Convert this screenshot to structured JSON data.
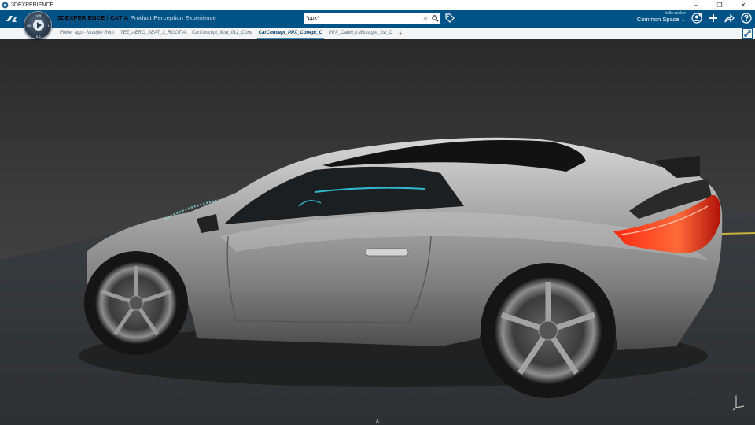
{
  "os": {
    "title": "3DEXPERIENCE",
    "minimize_glyph": "–",
    "maximize_glyph": "❐",
    "close_glyph": "✕"
  },
  "header": {
    "brand_bold": "3DEXPERIENCE",
    "brand_sep": " | ",
    "brand_app": "CATIA",
    "brand_role": " Product Perception Experience",
    "compass": {
      "north": "V.R",
      "west": "3D",
      "east": "i",
      "south": "6.0"
    }
  },
  "search": {
    "value": "*ppx*",
    "placeholder": "Search",
    "clear_glyph": "⊗"
  },
  "user": {
    "hello": "hello cocker",
    "space": "Common Space",
    "chevron": "⌄"
  },
  "tabs": [
    {
      "label": "Folder app - Multiple Root",
      "active": false
    },
    {
      "label": "TEZ_AERO_SEAT_2_ROOT A",
      "active": false
    },
    {
      "label": "CarConcept_final_fi12_Conc",
      "active": false
    },
    {
      "label": "CarConcept_PPX_Conept_C",
      "active": true
    },
    {
      "label": "PPX_Cabin_LeBourget_1st_C",
      "active": false
    }
  ],
  "tab_add_glyph": "+",
  "viewport": {
    "bottom_toggle_glyph": "˄"
  },
  "colors": {
    "brand_blue": "#005386",
    "accent_blue": "#3e93d0",
    "taillight": "#ff3a1a",
    "dash_cyan": "#35e1ff"
  }
}
